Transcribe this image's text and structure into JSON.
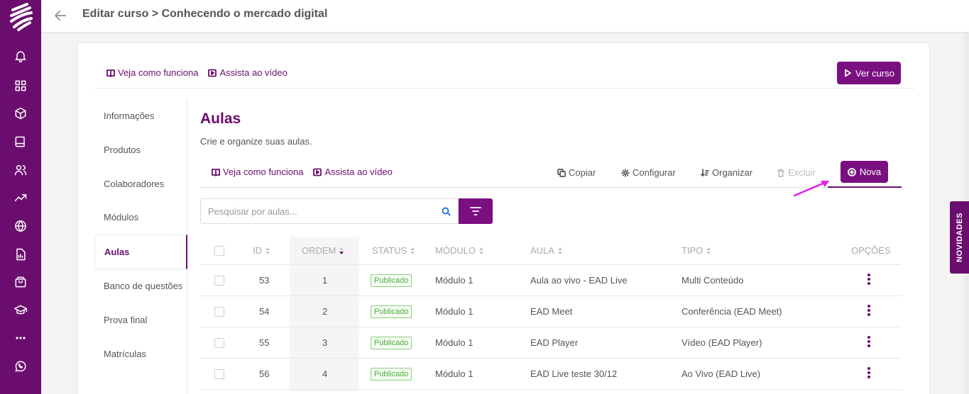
{
  "header": {
    "title": "Editar curso > Conhecendo o mercado digital"
  },
  "toplinks": {
    "how_it_works": "Veja como funciona",
    "watch_video": "Assista ao vídeo"
  },
  "view_course_label": "Ver curso",
  "sidemenu": {
    "items": [
      {
        "label": "Informações"
      },
      {
        "label": "Produtos"
      },
      {
        "label": "Colaboradores"
      },
      {
        "label": "Módulos"
      },
      {
        "label": "Aulas"
      },
      {
        "label": "Banco de questões"
      },
      {
        "label": "Prova final"
      },
      {
        "label": "Matrículas"
      }
    ],
    "active_index": 4
  },
  "content": {
    "title": "Aulas",
    "subtitle": "Crie e organize suas aulas.",
    "how_it_works": "Veja como funciona",
    "watch_video": "Assista ao vídeo",
    "actions": {
      "copy": "Copiar",
      "configure": "Configurar",
      "organize": "Organizar",
      "delete": "Excluir",
      "new": "Nova"
    },
    "search_placeholder": "Pesquisar por aulas..."
  },
  "table": {
    "columns": {
      "id": "ID",
      "order": "ORDEM",
      "status": "STATUS",
      "module": "MÓDULO",
      "lesson": "AULA",
      "type": "TIPO",
      "options": "OPÇÕES"
    },
    "rows": [
      {
        "id": "53",
        "order": "1",
        "status": "Publicado",
        "module": "Módulo 1",
        "lesson": "Aula ao vivo - EAD Live",
        "type": "Multi Conteúdo"
      },
      {
        "id": "54",
        "order": "2",
        "status": "Publicado",
        "module": "Módulo 1",
        "lesson": "EAD Meet",
        "type": "Conferência (EAD Meet)"
      },
      {
        "id": "55",
        "order": "3",
        "status": "Publicado",
        "module": "Módulo 1",
        "lesson": "EAD Player",
        "type": "Vídeo (EAD Player)"
      },
      {
        "id": "56",
        "order": "4",
        "status": "Publicado",
        "module": "Módulo 1",
        "lesson": "EAD Live teste 30/12",
        "type": "Ao Vivo (EAD Live)"
      }
    ]
  },
  "novidades_label": "NOVIDADES",
  "colors": {
    "brand": "#6b0d6e",
    "button": "#7a0f80",
    "status_green": "#4caf3c",
    "annotation": "#e61ee6"
  },
  "icons": {
    "rail": [
      "bell-icon",
      "grid-icon",
      "cube-icon",
      "book-icon",
      "users-icon",
      "trending-up-icon",
      "globe-icon",
      "report-icon",
      "shopping-bag-icon",
      "graduation-cap-icon",
      "more-horizontal-icon",
      "whatsapp-icon"
    ]
  }
}
